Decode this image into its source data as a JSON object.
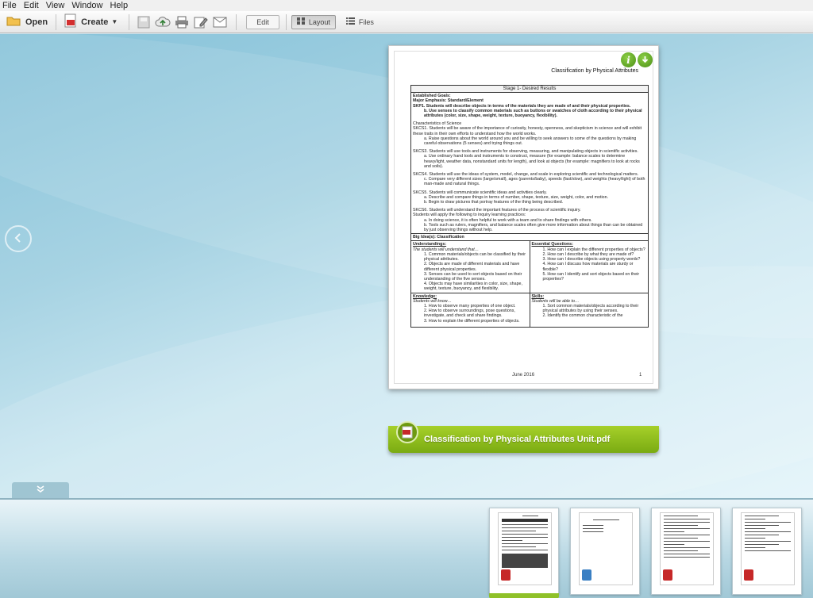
{
  "menu": [
    "File",
    "Edit",
    "View",
    "Window",
    "Help"
  ],
  "toolbar": {
    "open_label": "Open",
    "create_label": "Create",
    "edit_label": "Edit",
    "layout_label": "Layout",
    "files_label": "Files"
  },
  "document": {
    "header_title": "Classification by Physical Attributes",
    "stage_header": "Stage 1- Desired Results",
    "goals_title": "Established Goals:",
    "major_emphasis": "Major Emphasis:  Standard/Element",
    "skp1": "SKP1.  Students will describe objects in terms of the materials they are made of and their physical properties.",
    "skp1_b": "b.   Use senses to classify common materials such as buttons or swatches of cloth according to their physical attributes (color, size, shape, weight, texture, buoyancy, flexibility).",
    "char_title": "Characteristics of Science",
    "skcs1": "SKCS1.  Students will be aware of the importance of curiosity, honesty, openness, and skepticism in science and will exhibit these traits in their own efforts to understand how the world works.",
    "skcs1_a": "a.   Raise questions about the world around you and be willing to seek answers to some of the questions by making careful observations (5 senses) and trying things out.",
    "skcs3": "SKCS3.  Students will use tools and instruments for observing, measuring, and manipulating objects in scientific activities.",
    "skcs3_a": "a.   Use ordinary hand tools and instruments to construct, measure (for example: balance scales to determine heavy/light, weather data, nonstandard units for length), and look at objects (for example: magnifiers to look at rocks and soils).",
    "skcs4": "SKCS4.  Students will use the ideas of system, model, change, and scale in exploring scientific and technological matters.",
    "skcs4_c": "c.   Compare very different sizes (large/small), ages (parents/baby), speeds (fast/slow), and weights (heavy/light) of both man-made and natural things.",
    "skcs5": "SKCS5.  Students will communicate scientific ideas and activities clearly.",
    "skcs5_a": "a.   Describe and compare things in terms of number, shape, texture, size, weight, color, and motion.",
    "skcs5_b": "b.   Begin to draw pictures that portray features of the thing being described.",
    "skcs6": "SKCS6.  Students will understand the important features of the process of scientific inquiry.",
    "skcs6_line": "Students will apply the following to inquiry learning practices:",
    "skcs6_a": "a.   In doing science, it is often helpful to work with a team and to share findings with others.",
    "skcs6_b": "b.   Tools such as rulers, magnifiers, and balance scales often give more information about things than can be obtained by just observing things without help.",
    "big_idea": "Big Idea(s):  Classification",
    "understandings_title": "Understandings:",
    "understandings_sub": "The students will understand that…",
    "understandings": [
      "1.   Common materials/objects can be classified by their physical attributes.",
      "2.   Objects are made of different materials and have different physical properties.",
      "3.   Senses can be used to sort objects based on their understanding of the five senses.",
      "4.   Objects may have similarities in color, size, shape, weight, texture, buoyancy, and flexibility."
    ],
    "questions_title": "Essential Questions:",
    "questions": [
      "1.   How can I explain the different properties of objects?",
      "2.   How can I describe by what they are made of?",
      "3.   How can I describe objects using property words?",
      "4.   How can I discuss how materials are sturdy or flexible?",
      "5.   How can I identify and sort objects based on their properties?"
    ],
    "knowledge_title": "Knowledge:",
    "knowledge_sub": "Students will know…",
    "knowledge": [
      "1.   How to observe many properties of one object.",
      "2.   How to observe surroundings, pose questions, investigate, and check and share findings.",
      "3.   How to explain the different properties of objects."
    ],
    "skills_title": "Skills:",
    "skills_sub": "Students will be able to…",
    "skills": [
      "1.   Sort common materials/objects according to their physical attributes by using their senses.",
      "2.   Identify the common characteristic of the"
    ],
    "footer_date": "June 2016",
    "footer_page": "1",
    "filename": "Classification by Physical Attributes Unit.pdf"
  },
  "thumbnails": [
    {
      "name": "thumb-1",
      "selected": true,
      "type": "pdf"
    },
    {
      "name": "thumb-2",
      "selected": false,
      "type": "doc"
    },
    {
      "name": "thumb-3",
      "selected": false,
      "type": "pdf"
    },
    {
      "name": "thumb-4",
      "selected": false,
      "type": "pdf"
    }
  ],
  "colors": {
    "accent_green": "#8fc129",
    "pdf_red": "#c62828"
  }
}
